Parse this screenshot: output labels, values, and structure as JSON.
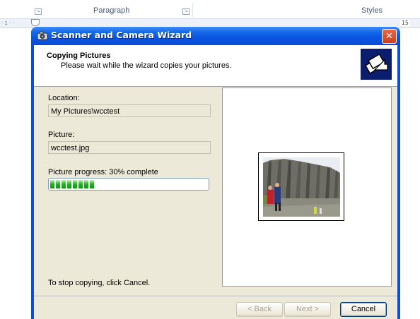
{
  "app": {
    "ribbon": {
      "group_paragraph": "Paragraph",
      "group_styles": "Styles"
    },
    "ruler": {
      "start_marks": "· 1 · ·",
      "end_number": "15"
    }
  },
  "wizard": {
    "title": "Scanner and Camera Wizard",
    "header": {
      "title": "Copying Pictures",
      "subtitle": "Please wait while the wizard copies your pictures."
    },
    "location": {
      "label": "Location:",
      "value": "My Pictures\\wcctest"
    },
    "picture": {
      "label": "Picture:",
      "value": "wcctest.jpg"
    },
    "progress": {
      "label": "Picture progress: 30% complete",
      "percent": 30,
      "color": "#1fb21f"
    },
    "stop_hint": "To stop copying, click Cancel.",
    "buttons": {
      "back": "< Back",
      "next": "Next >",
      "cancel": "Cancel"
    },
    "colors": {
      "titlebar": "#0a55e0",
      "dialog_bg": "#ece9d8",
      "close_button": "#c9401c"
    },
    "icons": {
      "title": "scanner-camera-icon",
      "header": "copy-pictures-icon",
      "close": "close-icon"
    }
  }
}
